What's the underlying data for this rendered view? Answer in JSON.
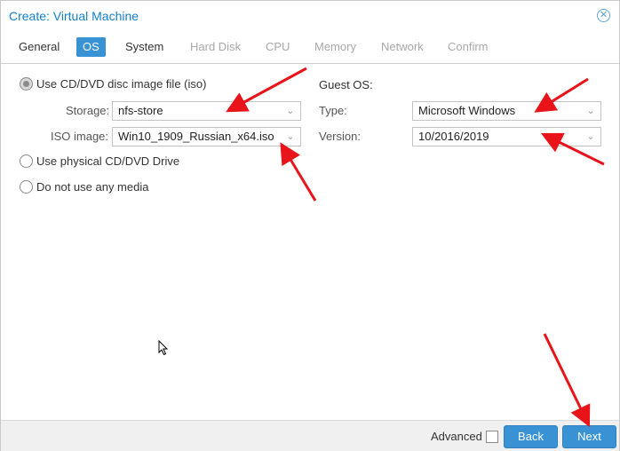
{
  "window": {
    "title": "Create: Virtual Machine"
  },
  "tabs": [
    {
      "label": "General",
      "state": "normal"
    },
    {
      "label": "OS",
      "state": "active"
    },
    {
      "label": "System",
      "state": "normal"
    },
    {
      "label": "Hard Disk",
      "state": "disabled"
    },
    {
      "label": "CPU",
      "state": "disabled"
    },
    {
      "label": "Memory",
      "state": "disabled"
    },
    {
      "label": "Network",
      "state": "disabled"
    },
    {
      "label": "Confirm",
      "state": "disabled"
    }
  ],
  "media": {
    "use_iso_label": "Use CD/DVD disc image file (iso)",
    "storage_label": "Storage:",
    "storage_value": "nfs-store",
    "iso_label": "ISO image:",
    "iso_value": "Win10_1909_Russian_x64.iso",
    "physical_label": "Use physical CD/DVD Drive",
    "none_label": "Do not use any media",
    "selected": "use_iso"
  },
  "guest_os": {
    "heading": "Guest OS:",
    "type_label": "Type:",
    "type_value": "Microsoft Windows",
    "version_label": "Version:",
    "version_value": "10/2016/2019"
  },
  "footer": {
    "advanced_label": "Advanced",
    "advanced_checked": false,
    "back_label": "Back",
    "next_label": "Next"
  },
  "colors": {
    "accent": "#3892d4",
    "title": "#157fcc",
    "annotation_arrow": "#e8141a"
  },
  "icons": [
    "close-icon",
    "chevron-down-icon",
    "mouse-pointer-icon",
    "red-annotation-arrow"
  ]
}
